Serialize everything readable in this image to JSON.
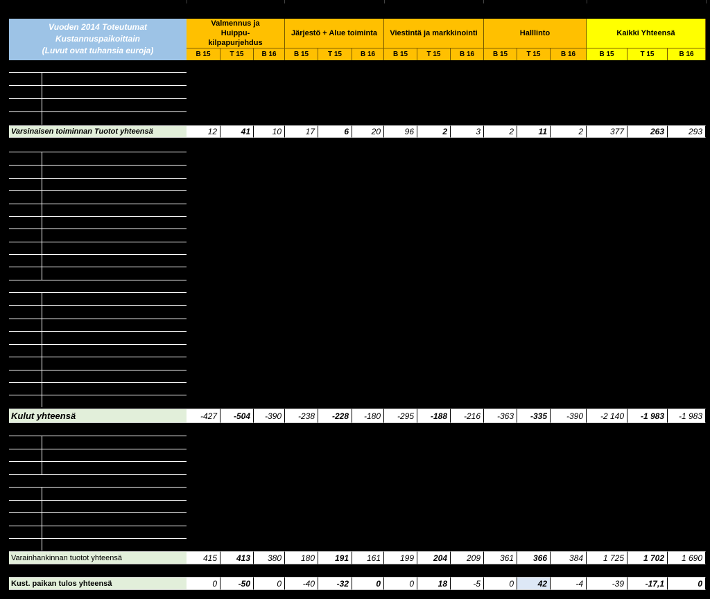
{
  "header": {
    "title_lines": [
      "Vuoden 2014 Toteutumat",
      "Kustannuspaikoittain",
      "(Luvut ovat tuhansia euroja)"
    ],
    "groups": [
      {
        "label": "Valmennus ja Huippu-kilpapurjehdus",
        "color": "#ffc000"
      },
      {
        "label": "Järjestö + Alue toiminta",
        "color": "#ffc000"
      },
      {
        "label": "Viestintä ja markkinointi",
        "color": "#ffc000"
      },
      {
        "label": "Halllinto",
        "color": "#ffc000"
      },
      {
        "label": "Kaikki Yhteensä",
        "color": "#ffff00"
      }
    ],
    "subcolumns": [
      "B 15",
      "T 15",
      "B 16"
    ]
  },
  "rows": [
    {
      "label": "Varsinaisen toiminnan Tuotot yhteensä",
      "values": [
        "12",
        "41",
        "10",
        "17",
        "6",
        "20",
        "96",
        "2",
        "3",
        "2",
        "11",
        "2",
        "377",
        "263",
        "293"
      ]
    },
    {
      "label": "Kulut yhteensä",
      "values": [
        "-427",
        "-504",
        "-390",
        "-238",
        "-228",
        "-180",
        "-295",
        "-188",
        "-216",
        "-363",
        "-335",
        "-390",
        "-2 140",
        "-1 983",
        "-1 983"
      ]
    },
    {
      "label": "Varainhankinnan tuotot yhteensä",
      "values": [
        "415",
        "413",
        "380",
        "180",
        "191",
        "161",
        "199",
        "204",
        "209",
        "361",
        "366",
        "384",
        "1 725",
        "1 702",
        "1 690"
      ]
    },
    {
      "label": "Kust. paikan tulos yhteensä",
      "values": [
        "0",
        "-50",
        "0",
        "-40",
        "-32",
        "0",
        "0",
        "18",
        "-5",
        "0",
        "42",
        "-4",
        "-39",
        "-17,1",
        "0"
      ]
    }
  ]
}
